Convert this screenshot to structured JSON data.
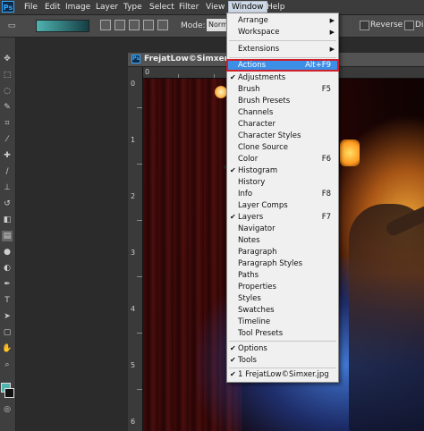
{
  "menubar": {
    "items": [
      "File",
      "Edit",
      "Image",
      "Layer",
      "Type",
      "Select",
      "Filter",
      "View",
      "Window",
      "Help"
    ],
    "active": "Window"
  },
  "options": {
    "mode_label": "Mode:",
    "mode_value": "Norm",
    "reverse_label": "Reverse",
    "dither_label": "Di"
  },
  "document": {
    "title": "FrejatLow©Simxer.jpg",
    "ruler_top": [
      "0"
    ],
    "ruler_left": [
      "0",
      "1",
      "2",
      "3",
      "4",
      "5",
      "6"
    ]
  },
  "window_menu": {
    "items": [
      {
        "label": "Arrange",
        "submenu": true
      },
      {
        "label": "Workspace",
        "submenu": true
      },
      {
        "label": "Extensions",
        "submenu": true
      },
      {
        "label": "Actions",
        "shortcut": "Alt+F9",
        "highlighted": true
      },
      {
        "label": "Adjustments",
        "checked": true
      },
      {
        "label": "Brush",
        "shortcut": "F5"
      },
      {
        "label": "Brush Presets"
      },
      {
        "label": "Channels"
      },
      {
        "label": "Character"
      },
      {
        "label": "Character Styles"
      },
      {
        "label": "Clone Source"
      },
      {
        "label": "Color",
        "shortcut": "F6"
      },
      {
        "label": "Histogram",
        "checked": true
      },
      {
        "label": "History"
      },
      {
        "label": "Info",
        "shortcut": "F8"
      },
      {
        "label": "Layer Comps"
      },
      {
        "label": "Layers",
        "shortcut": "F7",
        "checked": true
      },
      {
        "label": "Navigator"
      },
      {
        "label": "Notes"
      },
      {
        "label": "Paragraph"
      },
      {
        "label": "Paragraph Styles"
      },
      {
        "label": "Paths"
      },
      {
        "label": "Properties"
      },
      {
        "label": "Styles"
      },
      {
        "label": "Swatches"
      },
      {
        "label": "Timeline"
      },
      {
        "label": "Tool Presets"
      },
      {
        "label": "Options",
        "checked": true
      },
      {
        "label": "Tools",
        "checked": true
      },
      {
        "label": "1 FrejatLow©Simxer.jpg",
        "checked": true
      }
    ]
  },
  "colors": {
    "menu_highlight": "#3d8ee6",
    "highlight_outline": "#d0202a",
    "foreground_swatch": "#4fb3b0",
    "background_swatch": "#111111"
  },
  "icons": [
    "ps-logo",
    "move-tool-icon",
    "marquee-tool-icon",
    "lasso-tool-icon",
    "quick-select-icon",
    "crop-tool-icon",
    "eyedropper-icon",
    "healing-brush-icon",
    "brush-tool-icon",
    "clone-stamp-icon",
    "history-brush-icon",
    "eraser-icon",
    "gradient-tool-icon",
    "blur-tool-icon",
    "dodge-tool-icon",
    "pen-tool-icon",
    "type-tool-icon",
    "path-select-icon",
    "shape-tool-icon",
    "hand-tool-icon",
    "zoom-tool-icon"
  ]
}
